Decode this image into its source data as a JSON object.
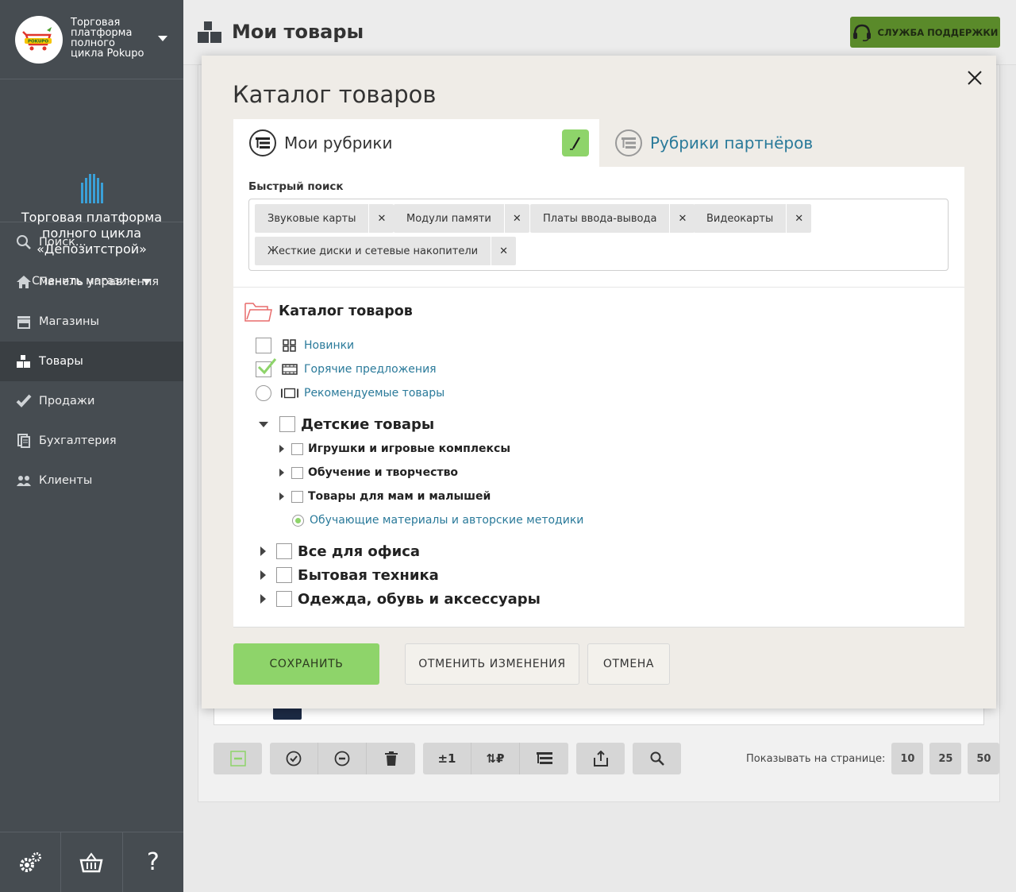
{
  "org": {
    "name": "Торговая платформа полного цикла Pokupo",
    "logo_text": "POKUPO"
  },
  "shop": {
    "name": "Торговая платформа полного цикла «Депозитстрой»",
    "switch_label": "Сменить магазин"
  },
  "nav": {
    "items": [
      {
        "label": "Поиск...",
        "icon": "search-icon"
      },
      {
        "label": "Панель управления",
        "icon": "home-icon"
      },
      {
        "label": "Магазины",
        "icon": "store-icon"
      },
      {
        "label": "Товары",
        "icon": "boxes-icon",
        "active": true
      },
      {
        "label": "Продажи",
        "icon": "check-icon"
      },
      {
        "label": "Бухгалтерия",
        "icon": "documents-icon"
      },
      {
        "label": "Клиенты",
        "icon": "users-icon"
      }
    ],
    "bottom": [
      {
        "icon": "gears-icon"
      },
      {
        "icon": "basket-icon"
      },
      {
        "label": "?",
        "icon": "help-icon"
      }
    ]
  },
  "page": {
    "title": "Мои товары",
    "support_label": "СЛУЖБА ПОДДЕРЖКИ"
  },
  "toolbar": {
    "groups": [
      [
        "minus-square-icon"
      ],
      [
        "check-circle-icon",
        "minus-circle-icon",
        "trash-icon"
      ],
      [
        "±1",
        "⇅₽",
        "catalog-icon"
      ],
      [
        "share-icon"
      ],
      [
        "search-icon"
      ]
    ],
    "quantity_label": "±1",
    "price_label": "⇅₽",
    "per_page_label": "Показывать на странице:",
    "per_page_options": [
      "10",
      "25",
      "50"
    ]
  },
  "modal": {
    "title": "Каталог товаров",
    "tabs": {
      "mine": "Мои рубрики",
      "partners": "Рубрики партнёров"
    },
    "quick_search": {
      "label": "Быстрый поиск",
      "chips": [
        "Звуковые карты",
        "Модули памяти",
        "Платы ввода-вывода",
        "Видеокарты",
        "Жесткие диски и сетевые накопители"
      ]
    },
    "catalog_root": "Каталог товаров",
    "special": [
      {
        "label": "Новинки",
        "control": "checkbox",
        "checked": false
      },
      {
        "label": "Горячие предложения",
        "control": "checkbox",
        "checked": true
      },
      {
        "label": "Рекомендуемые товары",
        "control": "radio",
        "checked": false
      }
    ],
    "tree": {
      "kids": {
        "label": "Детские товары",
        "children": [
          "Игрушки и игровые комплексы",
          "Обучение и творчество",
          "Товары для мам и малышей"
        ],
        "selected_child": "Обучающие материалы и авторские методики"
      },
      "others": [
        "Все для офиса",
        "Бытовая техника",
        "Одежда, обувь и аксессуары"
      ]
    },
    "buttons": {
      "save": "СОХРАНИТЬ",
      "revert": "ОТМЕНИТЬ ИЗМЕНЕНИЯ",
      "cancel": "ОТМЕНА"
    }
  },
  "colors": {
    "sidebar": "#464c51",
    "accent_green": "#8ed46a",
    "support_green": "#5a8a2a",
    "link": "#2a7a9a"
  }
}
